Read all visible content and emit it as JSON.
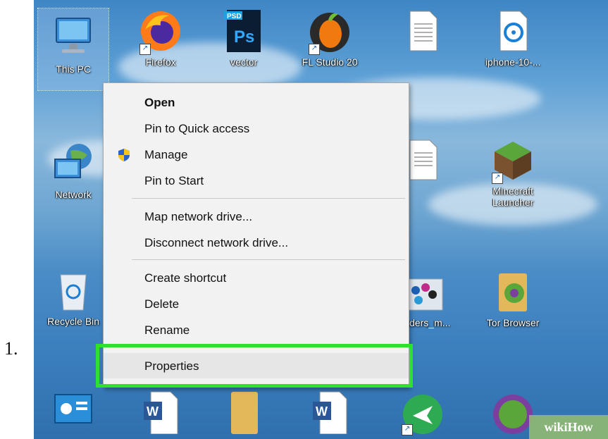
{
  "step_label": "1.",
  "desktop": {
    "icons": [
      {
        "id": "this-pc",
        "label": "This PC"
      },
      {
        "id": "firefox",
        "label": "Firefox"
      },
      {
        "id": "vector",
        "label": "vector"
      },
      {
        "id": "fl-studio",
        "label": "FL Studio 20"
      },
      {
        "id": "document",
        "label": ""
      },
      {
        "id": "iphone",
        "label": "iphone-10-..."
      },
      {
        "id": "network",
        "label": "Network"
      },
      {
        "id": "document2",
        "label": ""
      },
      {
        "id": "minecraft",
        "label": "Minecraft Launcher"
      },
      {
        "id": "recycle-bin",
        "label": "Recycle Bin"
      },
      {
        "id": "readers",
        "label": "readers_m..."
      },
      {
        "id": "tor-browser",
        "label": "Tor Browser"
      }
    ]
  },
  "context_menu": {
    "items": [
      {
        "label": "Open",
        "bold": true
      },
      {
        "label": "Pin to Quick access"
      },
      {
        "label": "Manage",
        "icon": "shield-icon"
      },
      {
        "label": "Pin to Start"
      },
      {
        "label": "Map network drive..."
      },
      {
        "label": "Disconnect network drive..."
      },
      {
        "label": "Create shortcut"
      },
      {
        "label": "Delete"
      },
      {
        "label": "Rename"
      },
      {
        "label": "Properties",
        "highlighted": true
      }
    ],
    "highlight_color": "#2fe02f"
  },
  "watermark": "wikiHow"
}
